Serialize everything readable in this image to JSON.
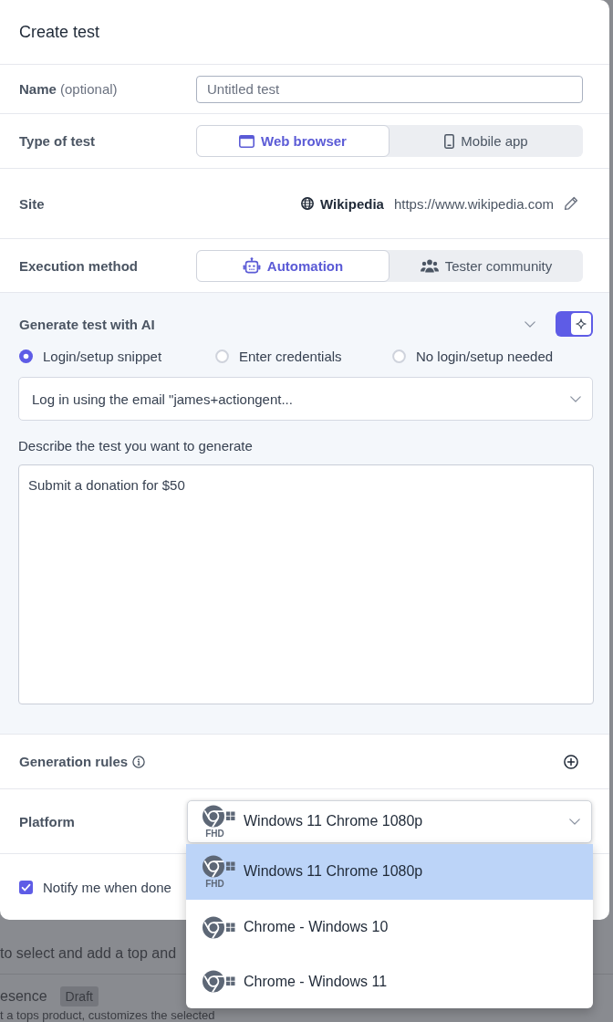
{
  "dialog": {
    "title": "Create test"
  },
  "name_field": {
    "label": "**Name** (optional)",
    "placeholder": "Untitled test"
  },
  "test_type": {
    "label": "Type of test",
    "options": [
      {
        "label": "Web browser",
        "selected": true
      },
      {
        "label": "Mobile app",
        "selected": false
      }
    ]
  },
  "site": {
    "label": "Site",
    "name": "Wikipedia",
    "url": "https://www.wikipedia.com"
  },
  "execution_method": {
    "label": "Execution method",
    "options": [
      {
        "label": "Automation",
        "selected": true
      },
      {
        "label": "Tester community",
        "selected": false
      }
    ]
  },
  "ai_generation": {
    "title": "Generate test with AI",
    "on": true,
    "login_options": [
      {
        "label": "Login/setup snippet",
        "selected": true
      },
      {
        "label": "Enter credentials",
        "selected": false
      },
      {
        "label": "No login/setup needed",
        "selected": false
      }
    ],
    "snippet": {
      "value": "Log in using the email \"james+actiongent..."
    },
    "description_label": "Describe the test you want to generate",
    "description": {
      "value": "Submit a donation for $50"
    }
  },
  "generation_rules": {
    "label": "Generation rules"
  },
  "platform": {
    "label": "Platform",
    "value": "Windows 11 Chrome 1080p",
    "badge": "FHD",
    "expanded": true,
    "options": [
      {
        "label": "Windows 11 Chrome 1080p",
        "badge": "FHD",
        "selected": true
      },
      {
        "label": "Chrome - Windows 10",
        "selected": false
      },
      {
        "label": "Chrome - Windows 11",
        "selected": false
      }
    ]
  },
  "notify": {
    "label": "Notify me when done",
    "checked": true
  },
  "background_page": {
    "text": "to select and add a top and",
    "item_title": "esence",
    "item_status": "Draft",
    "item_description": "t a tops product, customizes the selected"
  }
}
